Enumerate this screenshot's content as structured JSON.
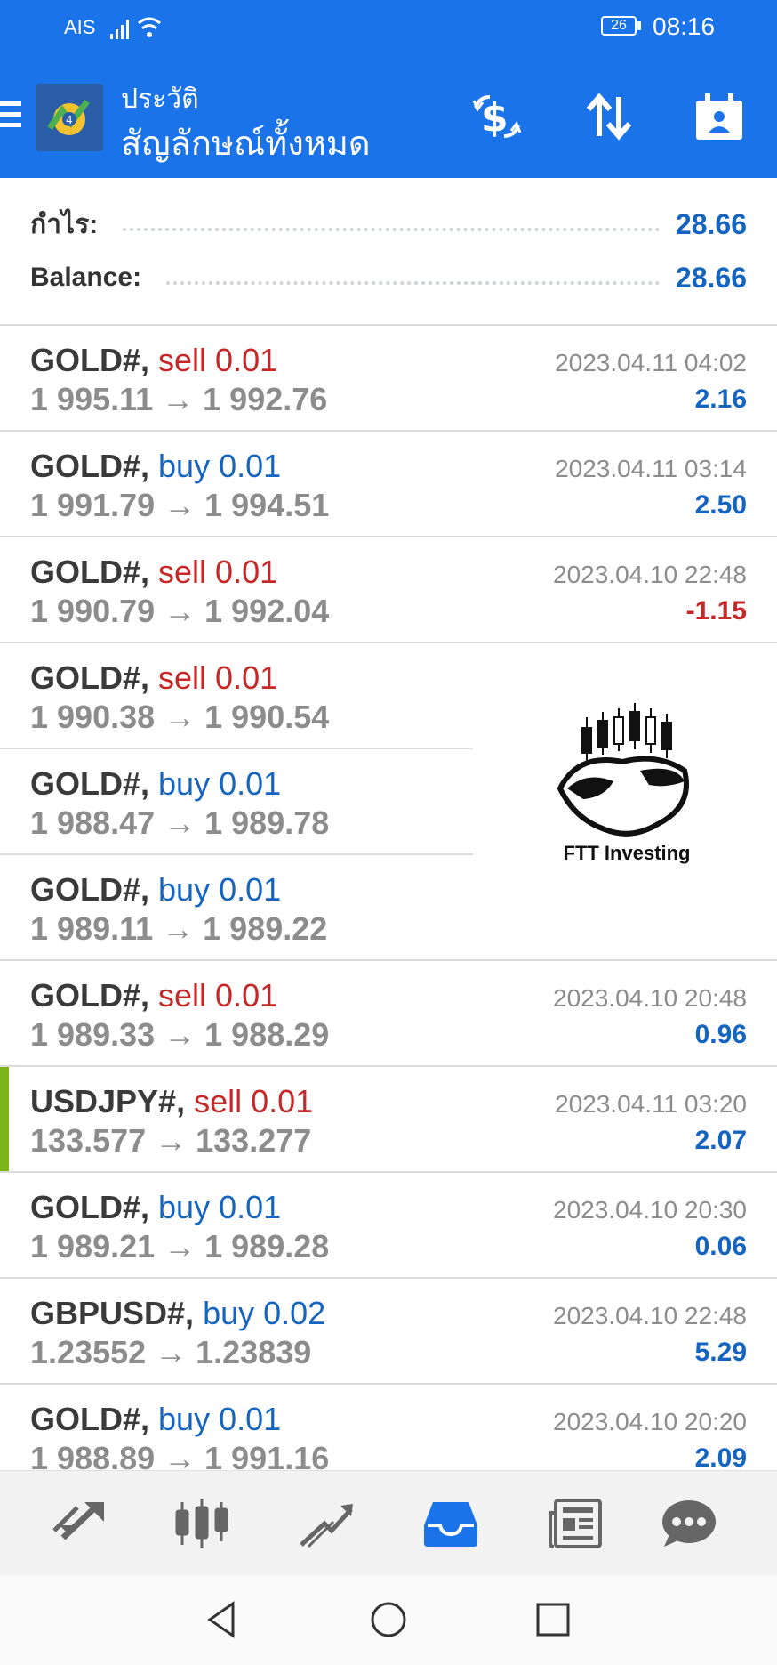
{
  "status_bar": {
    "carrier": "AIS",
    "battery": "26",
    "time": "08:16"
  },
  "app_bar": {
    "subtitle": "ประวัติ",
    "title": "สัญลักษณ์ทั้งหมด",
    "icons": [
      "menu-icon",
      "metatrader-logo",
      "dollar-exchange-icon",
      "sort-arrows-icon",
      "calendar-person-icon"
    ]
  },
  "summary": {
    "profit_label": "กำไร:",
    "profit_value": "28.66",
    "balance_label": "Balance:",
    "balance_value": "28.66"
  },
  "trades": [
    {
      "symbol": "GOLD#,",
      "side": "sell",
      "volume": "sell 0.01",
      "prices": "1 995.11 → 1 992.76",
      "time": "2023.04.11 04:02",
      "profit": "2.16"
    },
    {
      "symbol": "GOLD#,",
      "side": "buy",
      "volume": "buy 0.01",
      "prices": "1 991.79 → 1 994.51",
      "time": "2023.04.11 03:14",
      "profit": "2.50"
    },
    {
      "symbol": "GOLD#,",
      "side": "sell",
      "volume": "sell 0.01",
      "prices": "1 990.79 → 1 992.04",
      "time": "2023.04.10 22:48",
      "profit": "-1.15"
    },
    {
      "symbol": "GOLD#,",
      "side": "sell",
      "volume": "sell 0.01",
      "prices": "1 990.38 → 1 990.54",
      "time": "",
      "profit": ""
    },
    {
      "symbol": "GOLD#,",
      "side": "buy",
      "volume": "buy 0.01",
      "prices": "1 988.47 → 1 989.78",
      "time": "",
      "profit": ""
    },
    {
      "symbol": "GOLD#,",
      "side": "buy",
      "volume": "buy 0.01",
      "prices": "1 989.11 → 1 989.22",
      "time": "",
      "profit": ""
    },
    {
      "symbol": "GOLD#,",
      "side": "sell",
      "volume": "sell 0.01",
      "prices": "1 989.33 → 1 988.29",
      "time": "2023.04.10 20:48",
      "profit": "0.96"
    },
    {
      "symbol": "USDJPY#,",
      "side": "sell",
      "volume": "sell 0.01",
      "prices": "133.577 → 133.277",
      "time": "2023.04.11 03:20",
      "profit": "2.07"
    },
    {
      "symbol": "GOLD#,",
      "side": "buy",
      "volume": "buy 0.01",
      "prices": "1 989.21 → 1 989.28",
      "time": "2023.04.10 20:30",
      "profit": "0.06"
    },
    {
      "symbol": "GBPUSD#,",
      "side": "buy",
      "volume": "buy 0.02",
      "prices": "1.23552 → 1.23839",
      "time": "2023.04.10 22:48",
      "profit": "5.29"
    },
    {
      "symbol": "GOLD#,",
      "side": "buy",
      "volume": "buy 0.01",
      "prices": "1 988.89 → 1 991.16",
      "time": "2023.04.10 20:20",
      "profit": "2.09"
    }
  ],
  "watermark": {
    "text": "FTT Investing"
  },
  "tab_bar": {
    "tabs": [
      "quotes-icon",
      "chart-candles-icon",
      "trade-icon",
      "history-inbox-icon",
      "news-icon",
      "chat-icon"
    ],
    "active": "history-inbox-icon"
  },
  "colors": {
    "primary": "#1a73e8",
    "sell": "#c62828",
    "buy": "#1565c0",
    "accent_bar": "#7cb518"
  }
}
